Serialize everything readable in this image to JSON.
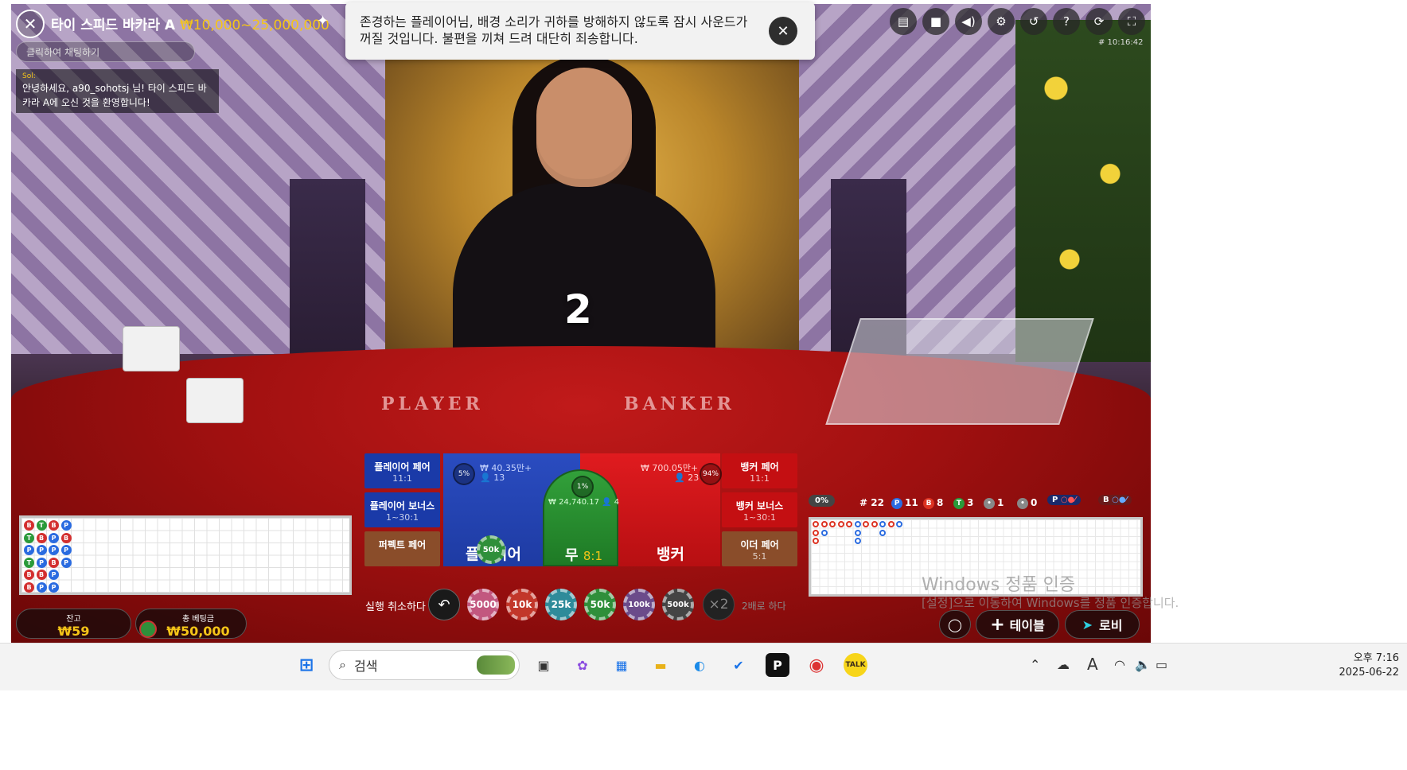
{
  "game": {
    "title": "타이 스피드 바카라 A",
    "limits": "₩10,000~25,000,000",
    "game_id": "# 10:16:42",
    "countdown": "2",
    "table_player_word": "PLAYER",
    "table_banker_word": "BANKER"
  },
  "chat": {
    "placeholder": "클릭하여 채팅하기",
    "message_author": "Sol:",
    "message_text": "안녕하세요, a90_sohotsj 님! 타이 스피드 바카라 A에 오신 것을 환영합니다!"
  },
  "notice": {
    "text": "존경하는 플레이어님, 배경 소리가 귀하를 방해하지 않도록 잠시 사운드가 꺼질 것입니다. 불편을 끼쳐 드려 대단히 죄송합니다."
  },
  "toolbar_icons": [
    "chat-icon",
    "video-icon",
    "sound-icon",
    "settings-icon",
    "history-icon",
    "help-icon",
    "refresh-icon",
    "fullscreen-icon"
  ],
  "bets": {
    "player_pair": {
      "label": "플레이어 페어",
      "odds": "11:1"
    },
    "player_bonus": {
      "label": "플레이어 보너스",
      "odds": "1~30:1"
    },
    "perfect_pair": {
      "label": "퍼펙트 페어",
      "odds": ""
    },
    "banker_pair": {
      "label": "뱅커 페어",
      "odds": "11:1"
    },
    "banker_bonus": {
      "label": "뱅커 보너스",
      "odds": "1~30:1"
    },
    "either_pair": {
      "label": "이더 페어",
      "odds": "5:1"
    },
    "player": {
      "label": "플레이어",
      "amount": "₩ 40.35만+",
      "players": "13",
      "pct": "5%"
    },
    "banker": {
      "label": "뱅커",
      "amount": "₩ 700.05만+",
      "players": "23",
      "pct": "94%"
    },
    "tie": {
      "label": "무",
      "odds": "8:1",
      "amount": "₩ 24,740.17",
      "players": "4",
      "pct": "1%"
    },
    "placed_chip": "50k"
  },
  "chips": {
    "undo_label": "실행 취소하다",
    "values": [
      "5000",
      "10k",
      "25k",
      "50k",
      "100k",
      "500k"
    ],
    "colors": [
      "#c2577f",
      "#c2372a",
      "#2e8b9a",
      "#2f8f3a",
      "#6b4b8a",
      "#444444"
    ],
    "double_symbol": "×2",
    "double_label": "2배로 하다"
  },
  "balance": {
    "balance_label": "잔고",
    "balance_value": "₩59",
    "total_bet_label": "총 베팅금",
    "total_bet_value": "₩50,000"
  },
  "bead_road": [
    [
      "B",
      "T",
      "B",
      "P"
    ],
    [
      "T",
      "B",
      "P",
      "B"
    ],
    [
      "P",
      "P",
      "P",
      "P"
    ],
    [
      "T",
      "P",
      "B",
      "P"
    ],
    [
      "B",
      "B",
      "P"
    ],
    [
      "B",
      "P",
      "P"
    ]
  ],
  "road_stats": {
    "pct": "0%",
    "rounds": "# 22",
    "player": "11",
    "banker": "8",
    "tie": "3",
    "p_pair": "1",
    "b_pair": "0",
    "p_predict": "P",
    "b_predict": "B"
  },
  "watermark": {
    "line1": "Windows 정품 인증",
    "line2": "[설정]으로 이동하여 Windows를 정품 인증합니다."
  },
  "bottom_buttons": {
    "table": "테이블",
    "lobby": "로비"
  },
  "taskbar": {
    "search_placeholder": "검색",
    "time": "오후 7:16",
    "date": "2025-06-22",
    "ime": "A"
  },
  "colors": {
    "player_blue": "#1e3ba3",
    "banker_red": "#c40f12",
    "tie_green": "#1e7a25",
    "gold": "#f5c518"
  }
}
